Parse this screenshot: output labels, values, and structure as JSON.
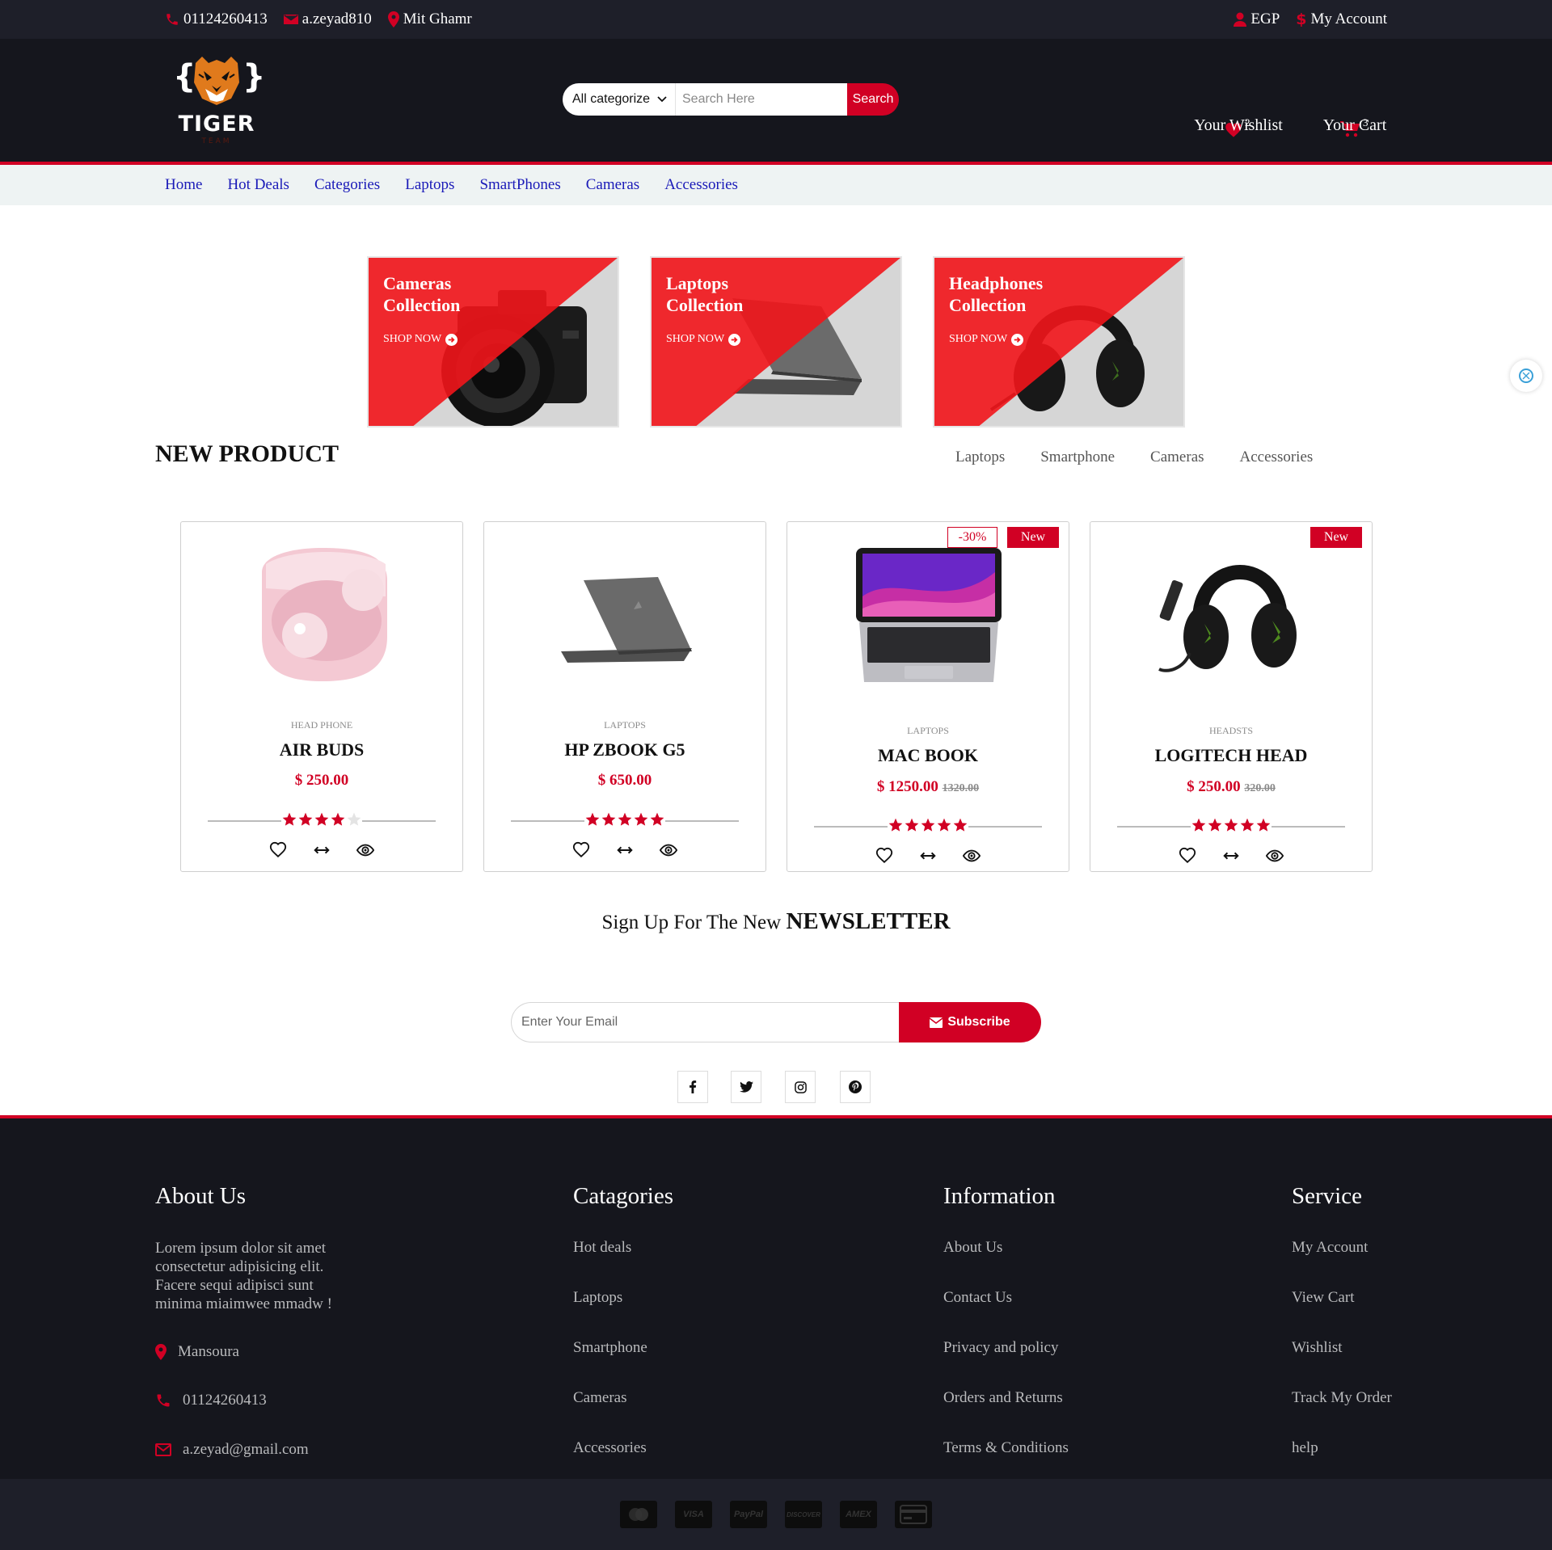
{
  "topbar": {
    "phone": "01124260413",
    "email": "a.zeyad810",
    "location": "Mit Ghamr",
    "currency": "EGP",
    "account": "My Account"
  },
  "header": {
    "logo_text": "TIGER",
    "logo_sub": "TEAM",
    "search_category": "All categorize",
    "search_placeholder": "Search Here",
    "search_button": "Search",
    "wishlist_label": "Your Wishlist",
    "wishlist_count": "2",
    "cart_label": "Your Cart",
    "cart_count": "3"
  },
  "nav": [
    "Home",
    "Hot Deals",
    "Categories",
    "Laptops",
    "SmartPhones",
    "Cameras",
    "Accessories"
  ],
  "collections": [
    {
      "title": "Cameras Collection",
      "cta": "SHOP NOW"
    },
    {
      "title": "Laptops Collection",
      "cta": "SHOP NOW"
    },
    {
      "title": "Headphones Collection",
      "cta": "SHOP NOW"
    }
  ],
  "new_product": {
    "title": "NEW PRODUCT",
    "tabs": [
      "Laptops",
      "Smartphone",
      "Cameras",
      "Accessories"
    ],
    "products": [
      {
        "category": "HEAD PHONE",
        "name": "AIR BUDS",
        "price": "$ 250.00",
        "old_price": "",
        "rating": 4,
        "sale": "",
        "new": ""
      },
      {
        "category": "LAPTOPS",
        "name": "HP ZBOOK G5",
        "price": "$ 650.00",
        "old_price": "",
        "rating": 5,
        "sale": "",
        "new": ""
      },
      {
        "category": "LAPTOPS",
        "name": "MAC BOOK",
        "price": "$ 1250.00",
        "old_price": "1320.00",
        "rating": 5,
        "sale": "-30%",
        "new": "New"
      },
      {
        "category": "HEADSTS",
        "name": "LOGITECH HEAD",
        "price": "$ 250.00",
        "old_price": "320.00",
        "rating": 5,
        "sale": "",
        "new": "New"
      }
    ]
  },
  "newsletter": {
    "title_prefix": "Sign Up For The New",
    "title_strong": "NEWSLETTER",
    "placeholder": "Enter Your Email",
    "button": "Subscribe",
    "social": [
      "facebook-icon",
      "twitter-icon",
      "instagram-icon",
      "pinterest-icon"
    ]
  },
  "footer": {
    "about": {
      "title": "About Us",
      "text": "Lorem ipsum dolor sit amet consectetur adipisicing elit. Facere sequi adipisci sunt minima miaimwee mmadw !",
      "address": "Mansoura",
      "phone": "01124260413",
      "email": "a.zeyad@gmail.com"
    },
    "categories": {
      "title": "Catagories",
      "links": [
        "Hot deals",
        "Laptops",
        "Smartphone",
        "Cameras",
        "Accessories"
      ]
    },
    "information": {
      "title": "Information",
      "links": [
        "About Us",
        "Contact Us",
        "Privacy and policy",
        "Orders and Returns",
        "Terms & Conditions"
      ]
    },
    "service": {
      "title": "Service",
      "links": [
        "My Account",
        "View Cart",
        "Wishlist",
        "Track My Order",
        "help"
      ]
    },
    "payments": [
      "mastercard-icon",
      "visa-icon",
      "paypal-icon",
      "discover-icon",
      "amex-icon",
      "credit-card-icon"
    ]
  },
  "colors": {
    "accent": "#d10024",
    "dark": "#15161d",
    "topbar": "#1e1f29",
    "nav_link": "#1a1ab8"
  }
}
